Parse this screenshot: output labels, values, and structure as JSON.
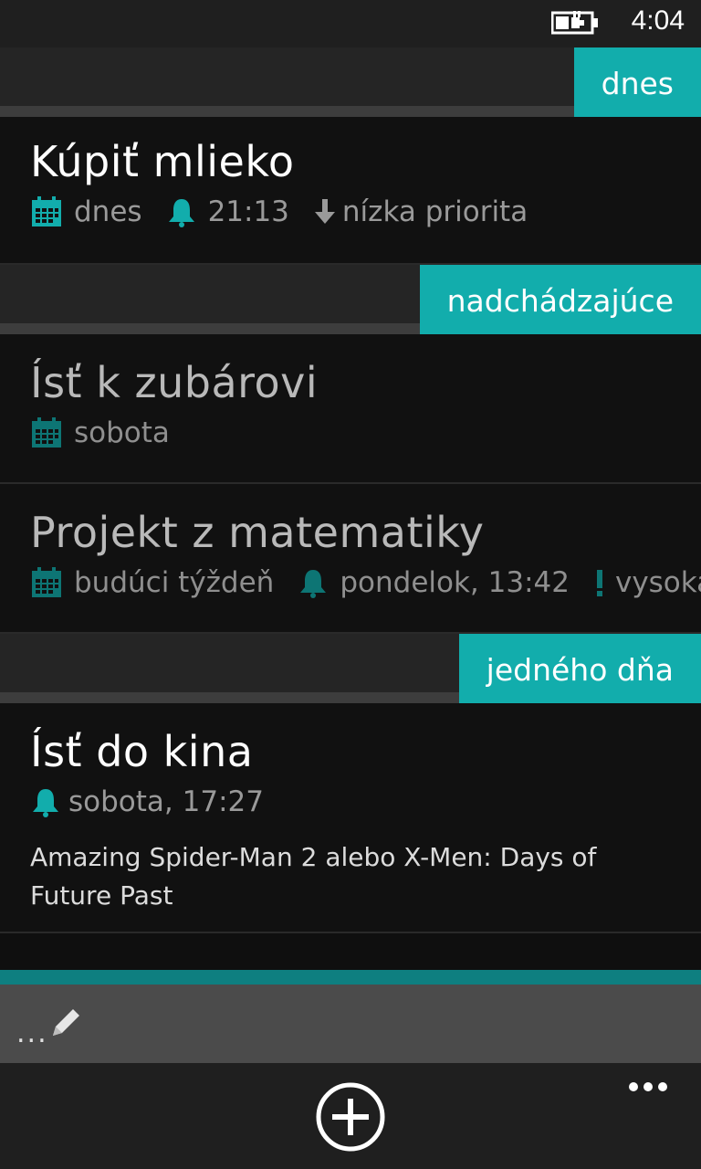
{
  "status_bar": {
    "time": "4:04",
    "battery_icon": "battery-charging-icon"
  },
  "sections": [
    {
      "label": "dnes",
      "tasks": [
        {
          "title": "Kúpiť mlieko",
          "date": "dnes",
          "reminder": "21:13",
          "priority": "nízka priorita",
          "priority_icon": "arrow-down-icon"
        }
      ]
    },
    {
      "label": "nadchádzajúce",
      "tasks": [
        {
          "title": "Ísť k zubárovi",
          "date": "sobota"
        },
        {
          "title": "Projekt z matematiky",
          "date": "budúci týždeň",
          "reminder": "pondelok, 13:42",
          "priority": "vysoká priorita",
          "priority_icon": "exclamation-icon"
        }
      ]
    },
    {
      "label": "jedného dňa",
      "tasks": [
        {
          "title": "Ísť do kina",
          "reminder": "sobota, 17:27",
          "note": "Amazing Spider-Man 2 alebo X-Men: Days of Future Past"
        }
      ]
    }
  ],
  "quick_add": {
    "dots": "...",
    "icon": "pencil-icon"
  },
  "app_bar": {
    "add_icon": "add-circle-icon",
    "more": "•••"
  },
  "colors": {
    "accent": "#12adac",
    "accent_dark": "#0e7f80",
    "background": "#0f0f0f"
  }
}
